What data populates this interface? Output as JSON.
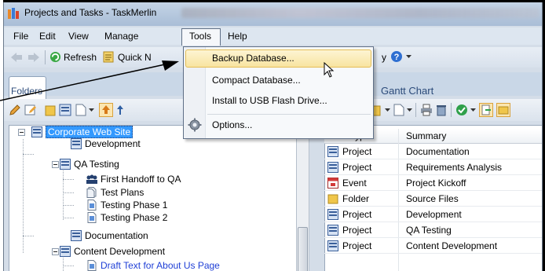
{
  "window": {
    "title": "Projects and Tasks - TaskMerlin"
  },
  "menubar": {
    "items": [
      "File",
      "Edit",
      "View",
      "Manage",
      "Tools",
      "Help"
    ]
  },
  "toolbar": {
    "refresh_label": "Refresh",
    "quick_label": "Quick N",
    "partial_label": "y"
  },
  "tabs": {
    "folders": "Folders",
    "gantt": "Gantt Chart"
  },
  "tools_menu": {
    "items": [
      "Backup Database...",
      "Compact Database...",
      "Install to USB Flash Drive...",
      "Options..."
    ]
  },
  "tree": {
    "items": [
      {
        "label": "Corporate Web Site"
      },
      {
        "label": "Development"
      },
      {
        "label": "QA Testing"
      },
      {
        "label": "First Handoff to QA"
      },
      {
        "label": "Test Plans"
      },
      {
        "label": "Testing Phase 1"
      },
      {
        "label": "Testing Phase 2"
      },
      {
        "label": "Documentation"
      },
      {
        "label": "Content Development"
      },
      {
        "label": "Draft Text for About Us Page"
      }
    ]
  },
  "list": {
    "columns": [
      "Item Type",
      "Summary"
    ],
    "rows": [
      {
        "type": "Project",
        "summary": "Documentation",
        "icon": "project-icon"
      },
      {
        "type": "Project",
        "summary": "Requirements Analysis",
        "icon": "project-icon"
      },
      {
        "type": "Event",
        "summary": "Project Kickoff",
        "icon": "event-icon"
      },
      {
        "type": "Folder",
        "summary": "Source Files",
        "icon": "folder-icon"
      },
      {
        "type": "Project",
        "summary": "Development",
        "icon": "project-icon"
      },
      {
        "type": "Project",
        "summary": "QA Testing",
        "icon": "project-icon"
      },
      {
        "type": "Project",
        "summary": "Content Development",
        "icon": "project-icon"
      }
    ]
  },
  "colors": {
    "selection": "#3399ff",
    "link_blue": "#1f3fd6",
    "menu_highlight": "#f8e4a0"
  }
}
